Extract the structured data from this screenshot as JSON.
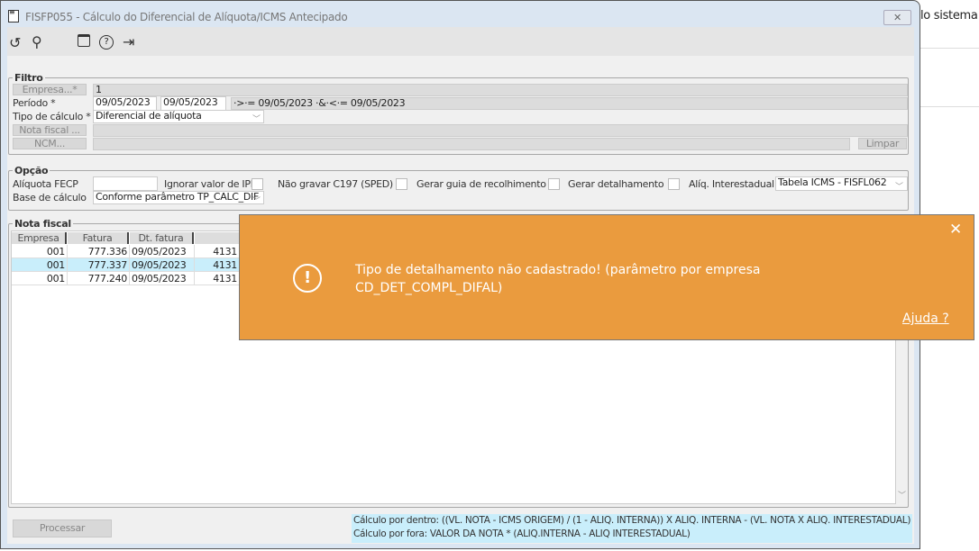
{
  "window": {
    "title": "FISFP055 - Cálculo do Diferencial de Alíquota/ICMS Antecipado",
    "close": "✕",
    "background_text": "lo sistema"
  },
  "toolbar": {
    "icons": [
      "refresh-icon",
      "search-icon",
      "calendar-icon",
      "help-icon",
      "exit-icon"
    ]
  },
  "filtro": {
    "legend": "Filtro",
    "empresa_btn": "Empresa...*",
    "empresa_value": "1",
    "periodo_label": "Período *",
    "periodo_start": "09/05/2023",
    "periodo_end": "09/05/2023",
    "periodo_expr": "·>·= 09/05/2023 ·&·<·= 09/05/2023",
    "tipo_label": "Tipo de cálculo *",
    "tipo_value": "Diferencial de alíquota",
    "nota_btn": "Nota fiscal ...",
    "ncm_btn": "NCM...",
    "limpar_btn": "Limpar"
  },
  "opcao": {
    "legend": "Opção",
    "fecp_label": "Alíquota FECP",
    "fecp_value": "",
    "ipi_label": "Ignorar valor de IPI",
    "c197_label": "Não gravar C197 (SPED)",
    "guia_label": "Gerar guia de recolhimento",
    "detalhamento_label": "Gerar detalhamento",
    "aliq_label": "Alíq. Interestadual",
    "aliq_value": "Tabela ICMS - FISFL062",
    "base_label": "Base de cálculo",
    "base_value": "Conforme parâmetro TP_CALC_DIF"
  },
  "nota": {
    "legend": "Nota fiscal",
    "columns": [
      "Empresa",
      "Fatura",
      "Dt. fatura",
      ""
    ],
    "rows": [
      {
        "empresa": "001",
        "fatura": "777.336",
        "dt": "09/05/2023",
        "col4": "4131"
      },
      {
        "empresa": "001",
        "fatura": "777.337",
        "dt": "09/05/2023",
        "col4": "4131",
        "selected": true
      },
      {
        "empresa": "001",
        "fatura": "777.240",
        "dt": "09/05/2023",
        "col4": "4131"
      }
    ]
  },
  "processar_btn": "Processar",
  "formula": {
    "line1": "Cálculo por dentro: ((VL. NOTA - ICMS ORIGEM) / (1 - ALIQ. INTERNA)) X ALIQ. INTERNA - (VL. NOTA X ALIQ. INTERESTADUAL)",
    "line2": "Cálculo por fora: VALOR DA NOTA * (ALIQ.INTERNA - ALIQ INTERESTADUAL)"
  },
  "toast": {
    "message_line1": "Tipo de detalhamento não cadastrado! (parâmetro por empresa",
    "message_line2": "CD_DET_COMPL_DIFAL)",
    "help_link": "Ajuda ?",
    "close": "✕",
    "color": "#ea9b3e"
  }
}
